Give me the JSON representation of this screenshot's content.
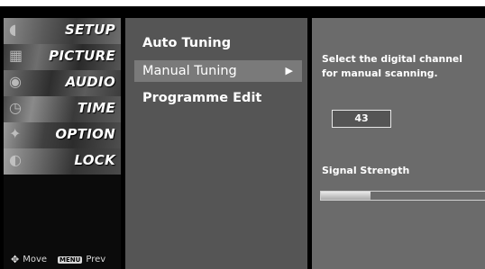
{
  "categories": [
    {
      "label": "SETUP",
      "icon": "satellite-dish-icon"
    },
    {
      "label": "PICTURE",
      "icon": "film-icon"
    },
    {
      "label": "AUDIO",
      "icon": "speaker-icon"
    },
    {
      "label": "TIME",
      "icon": "clock-icon"
    },
    {
      "label": "OPTION",
      "icon": "option-icon"
    },
    {
      "label": "LOCK",
      "icon": "lock-icon"
    }
  ],
  "legend": {
    "move_label": "Move",
    "menu_key": "MENU",
    "prev_label": "Prev"
  },
  "menu": {
    "items": [
      {
        "label": "Auto Tuning"
      },
      {
        "label": "Manual Tuning",
        "selected": true
      },
      {
        "label": "Programme Edit"
      }
    ],
    "arrow": "▶"
  },
  "detail": {
    "instruction": "Select the digital channel for manual scanning.",
    "channel_value": "43",
    "signal_label": "Signal Strength",
    "signal_strength": 0.3
  },
  "colors": {
    "menu_bg": "#555555",
    "selected_bg": "#7a7a7a",
    "detail_bg": "#6b6b6b"
  }
}
